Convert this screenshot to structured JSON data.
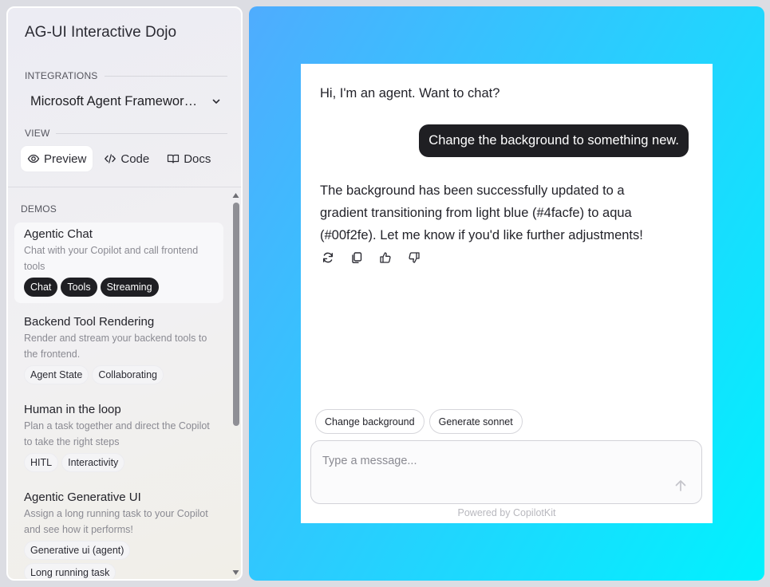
{
  "sidebar": {
    "app_title": "AG-UI Interactive Dojo",
    "integrations_label": "INTEGRATIONS",
    "integration_selected": "Microsoft Agent Framework (.NET)",
    "view_label": "VIEW",
    "view_tabs": [
      {
        "label": "Preview",
        "icon": "eye-icon",
        "active": true
      },
      {
        "label": "Code",
        "icon": "code-icon",
        "active": false
      },
      {
        "label": "Docs",
        "icon": "book-icon",
        "active": false
      }
    ],
    "demos_label": "DEMOS",
    "demos": [
      {
        "title": "Agentic Chat",
        "description": "Chat with your Copilot and call frontend tools",
        "tags": [
          "Chat",
          "Tools",
          "Streaming"
        ],
        "active": true
      },
      {
        "title": "Backend Tool Rendering",
        "description": "Render and stream your backend tools to the frontend.",
        "tags": [
          "Agent State",
          "Collaborating"
        ],
        "active": false
      },
      {
        "title": "Human in the loop",
        "description": "Plan a task together and direct the Copilot to take the right steps",
        "tags": [
          "HITL",
          "Interactivity"
        ],
        "active": false
      },
      {
        "title": "Agentic Generative UI",
        "description": "Assign a long running task to your Copilot and see how it performs!",
        "tags": [
          "Generative ui (agent)",
          "Long running task"
        ],
        "active": false
      }
    ]
  },
  "main": {
    "background_gradient": [
      "#4facfe",
      "#00f2fe"
    ],
    "chat": {
      "agent_greeting": "Hi, I'm an agent. Want to chat?",
      "user_message": "Change the background to something new.",
      "agent_reply": "The background has been successfully updated to a gradient transitioning from light blue (#4facfe) to aqua (#00f2fe). Let me know if you'd like further adjustments!",
      "message_actions": [
        "refresh-icon",
        "copy-icon",
        "thumbs-up-icon",
        "thumbs-down-icon"
      ],
      "suggestions": [
        "Change background",
        "Generate sonnet"
      ],
      "input_placeholder": "Type a message...",
      "input_value": "",
      "powered_by": "Powered by CopilotKit"
    }
  }
}
